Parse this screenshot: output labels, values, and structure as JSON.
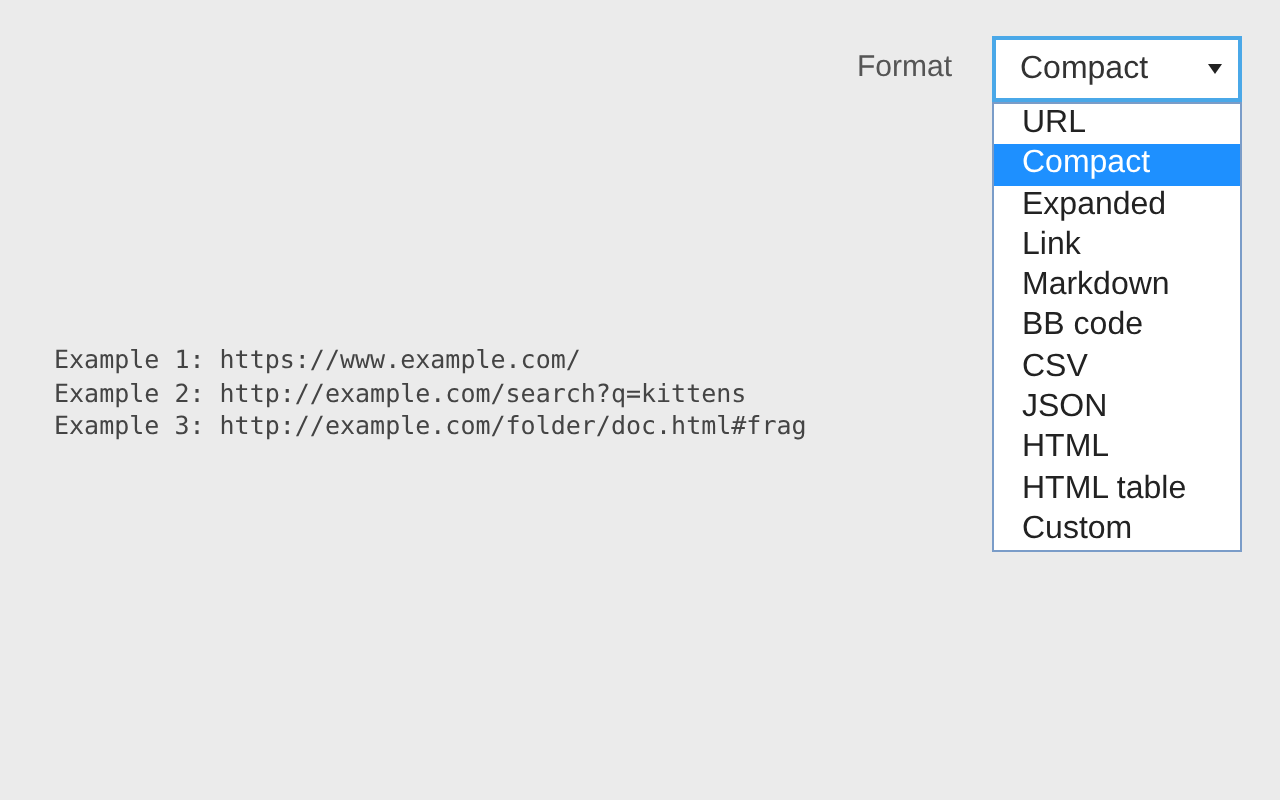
{
  "format": {
    "label": "Format",
    "value": "Compact",
    "options": [
      {
        "label": "URL",
        "selected": false
      },
      {
        "label": "Compact",
        "selected": true
      },
      {
        "label": "Expanded",
        "selected": false
      },
      {
        "label": "Link",
        "selected": false
      },
      {
        "label": "Markdown",
        "selected": false
      },
      {
        "label": "BB code",
        "selected": false
      },
      {
        "label": "CSV",
        "selected": false
      },
      {
        "label": "JSON",
        "selected": false
      },
      {
        "label": "HTML",
        "selected": false
      },
      {
        "label": "HTML table",
        "selected": false
      },
      {
        "label": "Custom",
        "selected": false
      }
    ]
  },
  "examples": [
    "Example 1: https://www.example.com/",
    "Example 2: http://example.com/search?q=kittens",
    "Example 3: http://example.com/folder/doc.html#frag"
  ]
}
